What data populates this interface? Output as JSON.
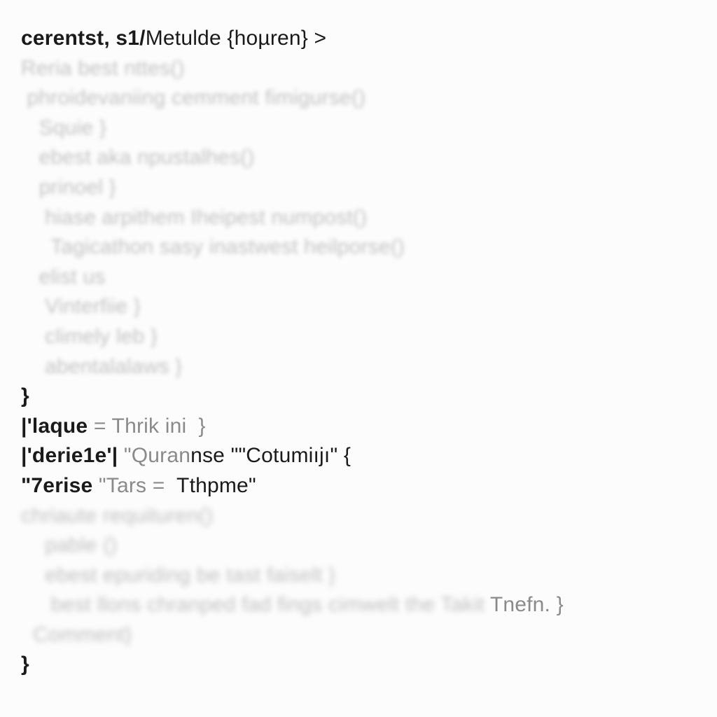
{
  "lines": {
    "l1a": "cerentst, s1/",
    "l1b": "Metulde {hoµren} >",
    "l2": "Reria best nttes()",
    "l3": " phroidevaniing cemment fimigurse()",
    "l4": "   Squie }",
    "l5": "   ebest aka npustalhes()",
    "l6": "   prinoel }",
    "l7": "    hiase arpithem Iheipest numpost()",
    "l8": "     Tagicathon sasy inastwest heilporse()",
    "l9": "   elist us",
    "l10": "    Vinterfiie }",
    "l11": "    climely leb }",
    "l12": "    abentalalaws }",
    "l13": "}",
    "l14a": "|'laque",
    "l14b": " = Thrik ini  }",
    "l15a": "|'derie1e'|",
    "l15b": " \"Quran",
    "l15c": "nse \"\"Cotumiıjı\" {",
    "l16a": "\"7erise ",
    "l16b": "\"Tars = ",
    "l16c": " Tthpme\"",
    "l17": "chriaute requituren()",
    "l18": "    pable ()",
    "l19": "    ebest epuriding be tast faiselt }",
    "l20a": "     best llons chranped fad fings cimwelt the Takit ",
    "l20b": "Tnefn. }",
    "l21": "  Comment}",
    "l22": "}"
  }
}
